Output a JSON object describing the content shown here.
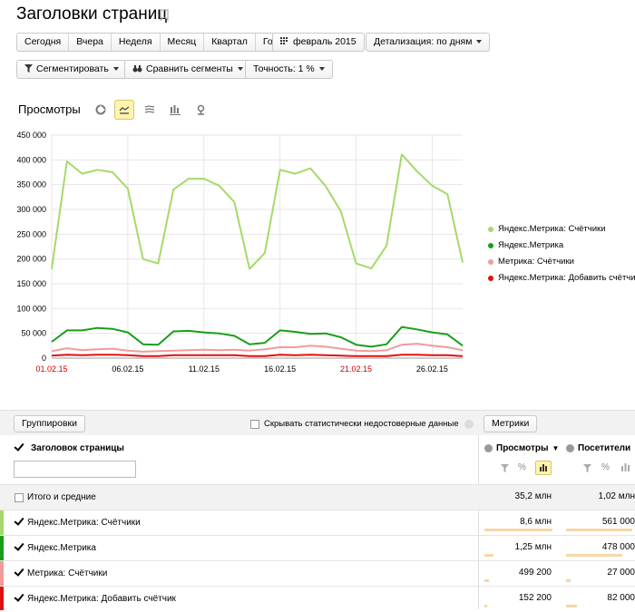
{
  "page": {
    "title": "Заголовки страниц"
  },
  "toolbar": {
    "periods": [
      "Сегодня",
      "Вчера",
      "Неделя",
      "Месяц",
      "Квартал",
      "Год"
    ],
    "date_range": "февраль 2015",
    "detail": "Детализация: по дням",
    "segment": "Сегментировать",
    "compare": "Сравнить сегменты",
    "accuracy": "Точность: 1 %"
  },
  "chart_header": {
    "title": "Просмотры",
    "icons": [
      "pie-chart-icon",
      "line-chart-icon",
      "stacked-area-icon",
      "bar-chart-icon",
      "map-icon"
    ],
    "active_icon": "line-chart-icon"
  },
  "chart_data": {
    "type": "line",
    "x": [
      "01.02.15",
      "02.02.15",
      "03.02.15",
      "04.02.15",
      "05.02.15",
      "06.02.15",
      "07.02.15",
      "08.02.15",
      "09.02.15",
      "10.02.15",
      "11.02.15",
      "12.02.15",
      "13.02.15",
      "14.02.15",
      "15.02.15",
      "16.02.15",
      "17.02.15",
      "18.02.15",
      "19.02.15",
      "20.02.15",
      "21.02.15",
      "22.02.15",
      "23.02.15",
      "24.02.15",
      "25.02.15",
      "26.02.15",
      "27.02.15",
      "28.02.15"
    ],
    "x_tick_labels": [
      "01.02.15",
      "06.02.15",
      "11.02.15",
      "16.02.15",
      "21.02.15",
      "26.02.15"
    ],
    "x_tick_colors": [
      "#cc0000",
      "#000000",
      "#000000",
      "#000000",
      "#cc0000",
      "#000000"
    ],
    "y_ticks": [
      "450 000",
      "400 000",
      "350 000",
      "300 000",
      "250 000",
      "200 000",
      "150 000",
      "100 000",
      "50 000",
      "0"
    ],
    "ylim": [
      0,
      450000
    ],
    "grid": true,
    "legend_position": "right",
    "series": [
      {
        "name": "Яндекс.Метрика: Счётчики",
        "color": "#a6d96a",
        "values": [
          180000,
          397000,
          372000,
          380000,
          375000,
          342000,
          200000,
          191000,
          340000,
          362000,
          362000,
          348000,
          315000,
          180000,
          212000,
          380000,
          372000,
          383000,
          347000,
          296000,
          191000,
          181000,
          227000,
          411000,
          377000,
          348000,
          331000,
          193000
        ]
      },
      {
        "name": "Яндекс.Метрика",
        "color": "#1a9e1a",
        "values": [
          33000,
          56000,
          56000,
          61000,
          59000,
          52000,
          28000,
          27000,
          54000,
          55000,
          52000,
          50000,
          45000,
          28000,
          31000,
          56000,
          53000,
          49000,
          50000,
          42000,
          27000,
          23000,
          28000,
          63000,
          58000,
          52000,
          48000,
          25000
        ]
      },
      {
        "name": "Метрика: Счётчики",
        "color": "#f29b9b",
        "values": [
          14000,
          20000,
          16000,
          18000,
          19000,
          15000,
          13000,
          14000,
          15000,
          16000,
          17000,
          16000,
          17000,
          15000,
          18000,
          22000,
          22000,
          25000,
          23000,
          19000,
          15000,
          14000,
          16000,
          27000,
          29000,
          25000,
          22000,
          16000
        ]
      },
      {
        "name": "Яндекс.Метрика: Добавить счётчик",
        "color": "#e01010",
        "values": [
          5000,
          7000,
          6000,
          7000,
          7000,
          6000,
          4000,
          4000,
          6000,
          6000,
          6000,
          6000,
          6000,
          4000,
          4000,
          7000,
          6000,
          7000,
          6000,
          5000,
          4000,
          4000,
          4000,
          7000,
          7000,
          6000,
          6000,
          4000
        ]
      }
    ]
  },
  "table": {
    "groupings_button": "Группировки",
    "hide_unreliable_label": "Скрывать статистически недостоверные данные",
    "metrics_button": "Метрики",
    "dimension_header": "Заголовок страницы",
    "col1_header": "Просмотры",
    "col2_header": "Посетители",
    "totals_label": "Итого и средние",
    "totals_v1": "35,2 млн",
    "totals_v2": "1,02 млн",
    "rows": [
      {
        "label": "Яндекс.Метрика: Счётчики",
        "v1": "8,6 млн",
        "v2": "561 000",
        "color": "#a6d96a",
        "bar1": 0.9,
        "bar2": 0.95
      },
      {
        "label": "Яндекс.Метрика",
        "v1": "1,25 млн",
        "v2": "478 000",
        "color": "#1a9e1a",
        "bar1": 0.12,
        "bar2": 0.8
      },
      {
        "label": "Метрика: Счётчики",
        "v1": "499 200",
        "v2": "27 000",
        "color": "#f29b9b",
        "bar1": 0.05,
        "bar2": 0.05
      },
      {
        "label": "Яндекс.Метрика: Добавить счётчик",
        "v1": "152 200",
        "v2": "82 000",
        "color": "#e01010",
        "bar1": 0.02,
        "bar2": 0.15
      }
    ]
  }
}
